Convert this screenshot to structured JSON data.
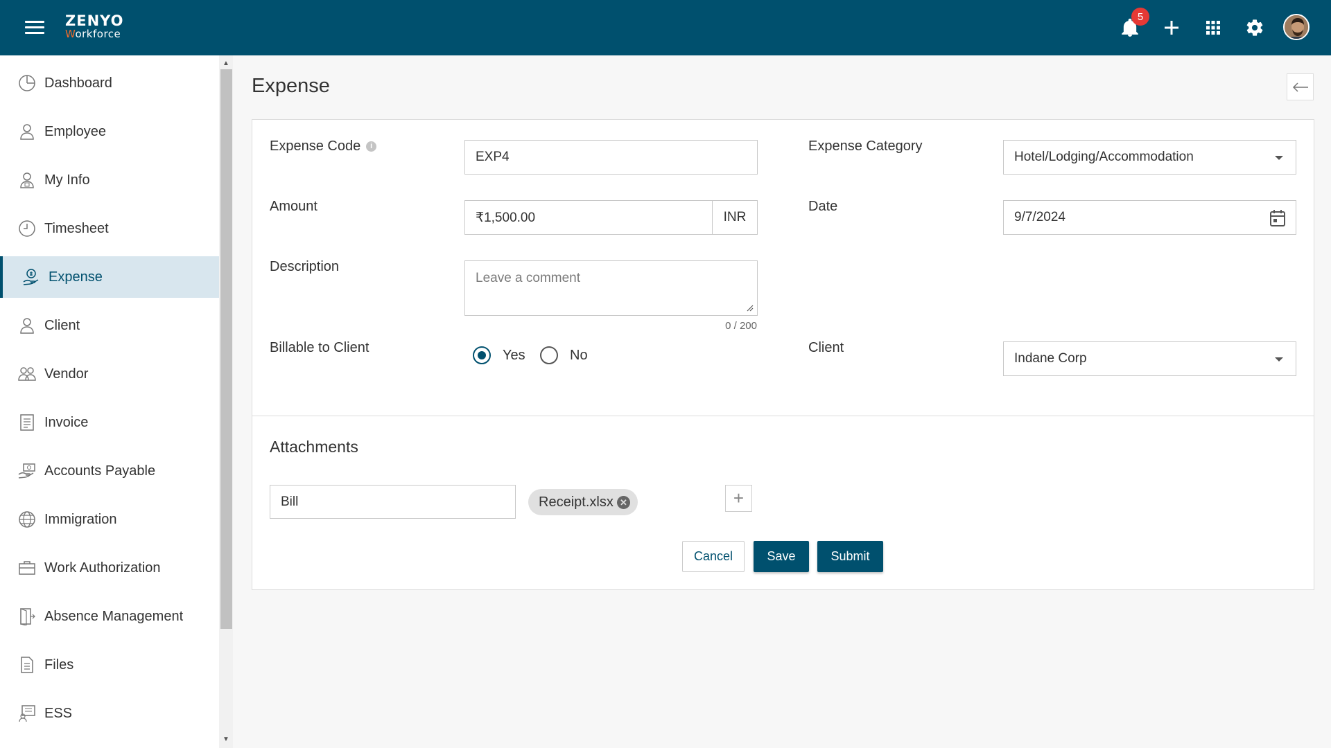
{
  "app": {
    "logo_line1": "ZENYO",
    "logo_line2_accent": "W",
    "logo_line2_rest": "orkforce",
    "notification_count": "5"
  },
  "icons": {
    "menu": "hamburger-menu-icon",
    "notifications": "bell-icon",
    "add": "plus-icon",
    "apps": "grid-icon",
    "settings": "gear-icon",
    "back": "arrow-left-icon",
    "calendar": "calendar-icon"
  },
  "sidebar": {
    "items": [
      {
        "label": "Dashboard",
        "icon": "dashboard-icon"
      },
      {
        "label": "Employee",
        "icon": "employee-icon"
      },
      {
        "label": "My Info",
        "icon": "my-info-icon"
      },
      {
        "label": "Timesheet",
        "icon": "clock-icon"
      },
      {
        "label": "Expense",
        "icon": "expense-icon",
        "active": true
      },
      {
        "label": "Client",
        "icon": "client-icon"
      },
      {
        "label": "Vendor",
        "icon": "vendor-icon"
      },
      {
        "label": "Invoice",
        "icon": "invoice-icon"
      },
      {
        "label": "Accounts Payable",
        "icon": "accounts-payable-icon"
      },
      {
        "label": "Immigration",
        "icon": "globe-icon"
      },
      {
        "label": "Work Authorization",
        "icon": "briefcase-icon"
      },
      {
        "label": "Absence Management",
        "icon": "door-icon"
      },
      {
        "label": "Files",
        "icon": "file-icon"
      },
      {
        "label": "ESS",
        "icon": "ess-icon"
      }
    ]
  },
  "page": {
    "title": "Expense"
  },
  "form": {
    "expense_code_label": "Expense Code",
    "expense_code_value": "EXP4",
    "expense_category_label": "Expense Category",
    "expense_category_value": "Hotel/Lodging/Accommodation",
    "amount_label": "Amount",
    "amount_value": "₹1,500.00",
    "amount_currency": "INR",
    "date_label": "Date",
    "date_value": "9/7/2024",
    "description_label": "Description",
    "description_placeholder": "Leave a comment",
    "description_counter": "0 / 200",
    "billable_label": "Billable to Client",
    "billable_yes": "Yes",
    "billable_no": "No",
    "billable_selected": "Yes",
    "client_label": "Client",
    "client_value": "Indane Corp"
  },
  "attachments": {
    "title": "Attachments",
    "name_value": "Bill",
    "file_chip": "Receipt.xlsx"
  },
  "actions": {
    "cancel": "Cancel",
    "save": "Save",
    "submit": "Submit"
  },
  "colors": {
    "header": "#00506e",
    "accent": "#f26b2a",
    "badge": "#e53935",
    "active_nav_bg": "#d8e6ee"
  }
}
